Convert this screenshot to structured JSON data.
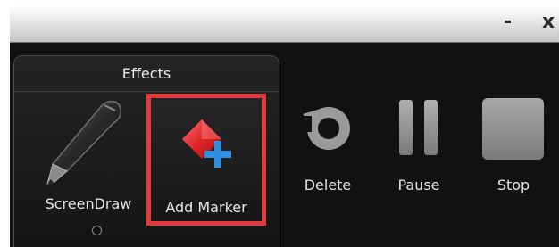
{
  "window": {
    "minimize_label": "-",
    "close_label": "x"
  },
  "effects_group": {
    "title": "Effects",
    "screendraw": {
      "label": "ScreenDraw",
      "icon": "pen-icon"
    },
    "add_marker": {
      "label": "Add Marker",
      "icon": "marker-add-icon",
      "highlight_color": "#e23b3b"
    }
  },
  "controls": {
    "delete": {
      "label": "Delete",
      "icon": "rotate-icon"
    },
    "pause": {
      "label": "Pause",
      "icon": "pause-icon"
    },
    "stop": {
      "label": "Stop",
      "icon": "stop-icon"
    }
  },
  "colors": {
    "background": "#111111",
    "text": "#e6e6e6",
    "marker_red": "#e02828",
    "plus_blue": "#2f8fe0",
    "icon_gray": "#9a9a9a"
  }
}
